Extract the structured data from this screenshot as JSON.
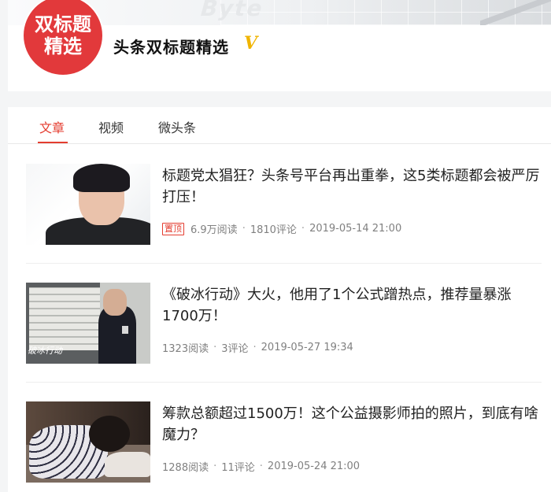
{
  "profile": {
    "avatar_line1": "双标题",
    "avatar_line2": "精选",
    "name": "头条双标题精选",
    "verified_mark": "V"
  },
  "tabs": [
    {
      "label": "文章",
      "active": true
    },
    {
      "label": "视频",
      "active": false
    },
    {
      "label": "微头条",
      "active": false
    }
  ],
  "articles": [
    {
      "title": "标题党太猖狂？头条号平台再出重拳，这5类标题都会被严厉打压！",
      "pinned_label": "置顶",
      "reads": "6.9万阅读",
      "comments": "1810评论",
      "date": "2019-05-14 21:00"
    },
    {
      "title": "《破冰行动》大火，他用了1个公式蹭热点，推荐量暴涨1700万！",
      "reads": "1323阅读",
      "comments": "3评论",
      "date": "2019-05-27 19:34"
    },
    {
      "title": "筹款总额超过1500万！这个公益摄影师拍的照片，到底有啥魔力？",
      "reads": "1288阅读",
      "comments": "11评论",
      "date": "2019-05-24 21:00"
    }
  ],
  "colors": {
    "accent": "#e43d30",
    "avatar_bg": "#e2393b",
    "verified": "#f0b400",
    "meta_text": "#808080"
  },
  "icons": {
    "verified": "verified-v-icon"
  }
}
